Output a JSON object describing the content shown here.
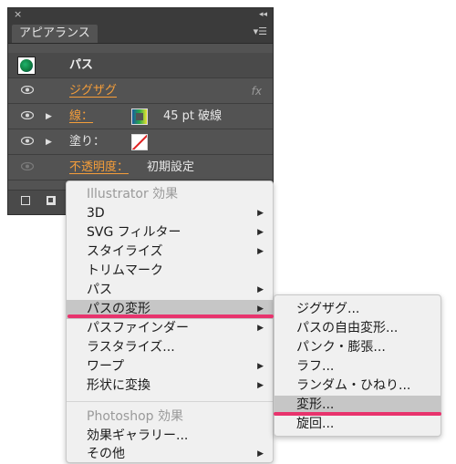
{
  "panel": {
    "close_glyph": "×",
    "collapse_glyph": "◂◂",
    "tab_label": "アピアランス",
    "menu_glyph": "▾☰",
    "path_title": "パス",
    "rows": [
      {
        "label": "ジグザグ",
        "fx": "fx"
      },
      {
        "label": "線：",
        "value": "45 pt 破線"
      },
      {
        "label": "塗り："
      },
      {
        "label": "不透明度：",
        "value": "初期設定"
      }
    ]
  },
  "menu": {
    "header1": "Illustrator 効果",
    "items": [
      {
        "label": "3D",
        "arrow": "▶"
      },
      {
        "label": "SVG フィルター",
        "arrow": "▶"
      },
      {
        "label": "スタイライズ",
        "arrow": "▶"
      },
      {
        "label": "トリムマーク",
        "arrow": ""
      },
      {
        "label": "パス",
        "arrow": "▶"
      },
      {
        "label": "パスの変形",
        "arrow": "▶"
      },
      {
        "label": "パスファインダー",
        "arrow": "▶"
      },
      {
        "label": "ラスタライズ...",
        "arrow": ""
      },
      {
        "label": "ワープ",
        "arrow": "▶"
      },
      {
        "label": "形状に変換",
        "arrow": "▶"
      }
    ],
    "header2": "Photoshop 効果",
    "items2": [
      {
        "label": "効果ギャラリー..."
      },
      {
        "label": "その他",
        "arrow": "▶"
      }
    ]
  },
  "submenu": {
    "items": [
      {
        "label": "ジグザグ..."
      },
      {
        "label": "パスの自由変形..."
      },
      {
        "label": "パンク・膨張..."
      },
      {
        "label": "ラフ..."
      },
      {
        "label": "ランダム・ひねり..."
      },
      {
        "label": "変形..."
      },
      {
        "label": "旋回..."
      }
    ]
  },
  "colors": {
    "highlight_marker": "#e8336d",
    "accent_orange": "#f59e3a",
    "panel_bg": "#535353",
    "menu_bg": "#f0f0f0",
    "menu_highlight": "#c6c6c6"
  }
}
